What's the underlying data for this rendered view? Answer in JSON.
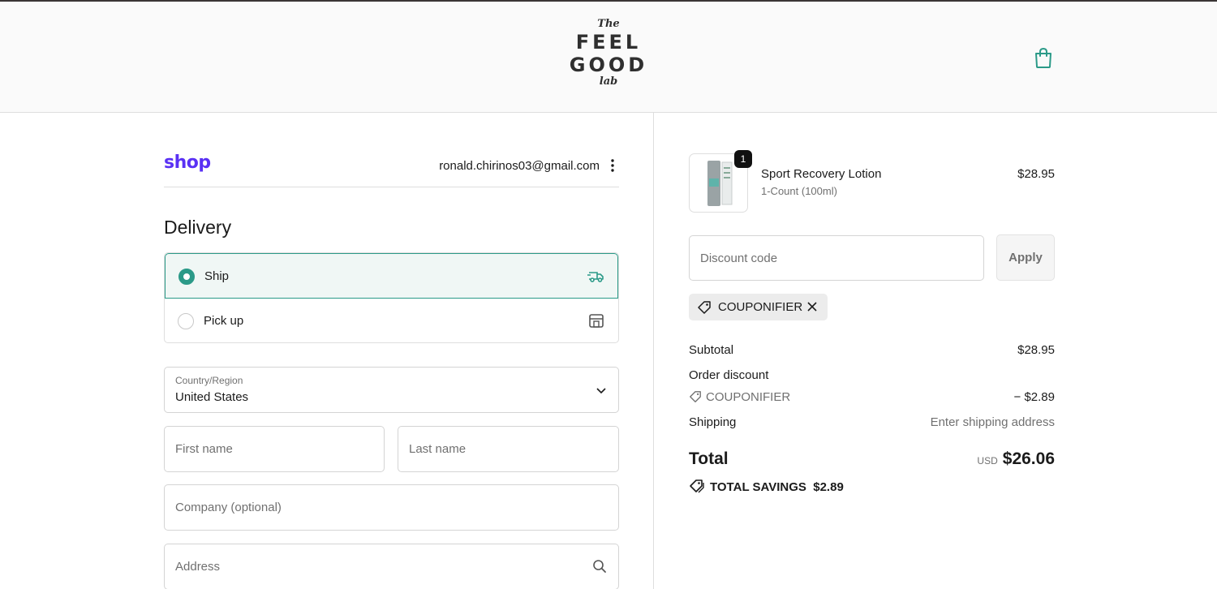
{
  "header": {
    "logo_the": "The",
    "logo_word1": "FEEL",
    "logo_word2": "GOOD",
    "logo_lab": "lab",
    "cart_icon": "shopping-bag-icon",
    "accent": "#2b9a88"
  },
  "account": {
    "shop_logo": "shop",
    "email": "ronald.chirinos03@gmail.com"
  },
  "delivery": {
    "heading": "Delivery",
    "options": [
      {
        "label": "Ship",
        "selected": true,
        "icon": "truck-icon"
      },
      {
        "label": "Pick up",
        "selected": false,
        "icon": "store-icon"
      }
    ]
  },
  "form": {
    "country_label": "Country/Region",
    "country_value": "United States",
    "first_name_placeholder": "First name",
    "last_name_placeholder": "Last name",
    "company_placeholder": "Company (optional)",
    "address_placeholder": "Address"
  },
  "order": {
    "item": {
      "name": "Sport Recovery Lotion",
      "variant": "1-Count (100ml)",
      "price": "$28.95",
      "quantity": "1"
    },
    "discount_placeholder": "Discount code",
    "apply_label": "Apply",
    "applied_code": "COUPONIFIER",
    "subtotal_label": "Subtotal",
    "subtotal_value": "$28.95",
    "order_discount_label": "Order discount",
    "discount_code": "COUPONIFIER",
    "discount_value": "− $2.89",
    "shipping_label": "Shipping",
    "shipping_value": "Enter shipping address",
    "total_label": "Total",
    "currency": "USD",
    "total_value": "$26.06",
    "savings_label": "TOTAL SAVINGS",
    "savings_value": "$2.89"
  }
}
